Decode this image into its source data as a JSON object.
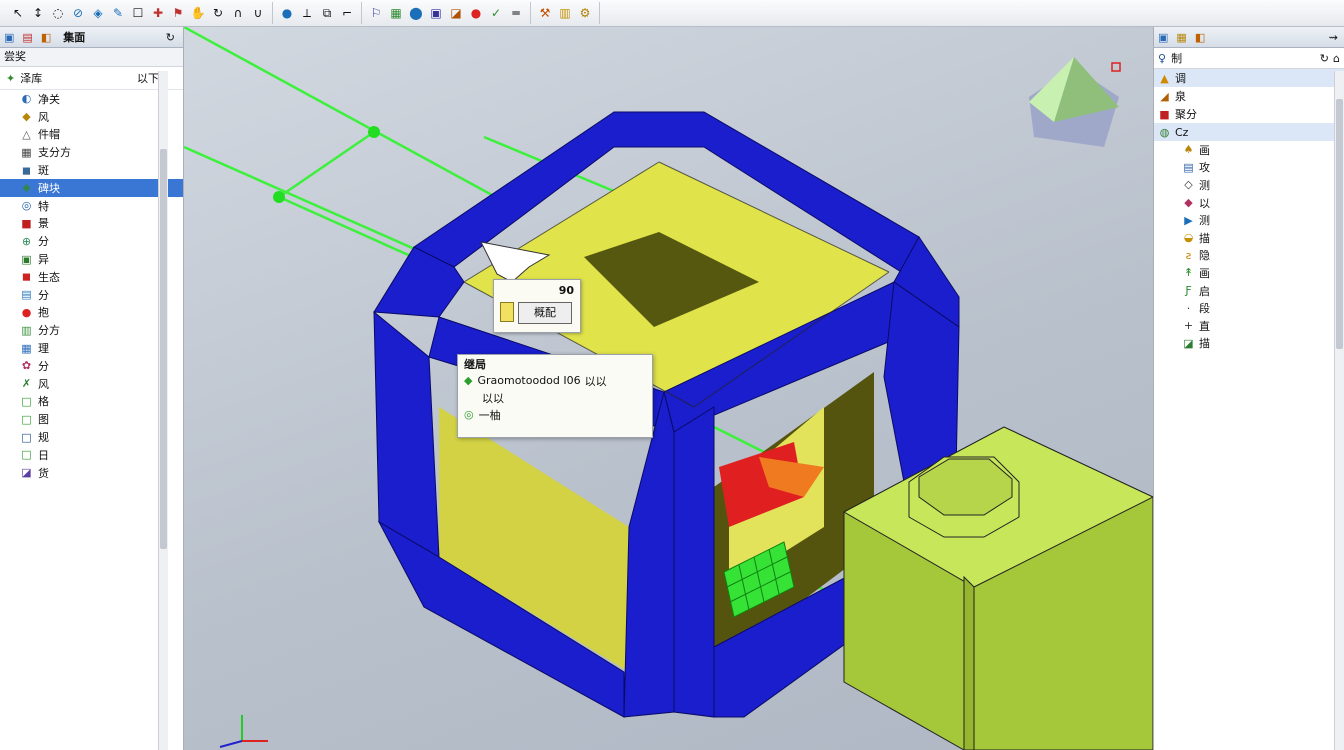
{
  "toolbar": {
    "groups": [
      [
        "arrow-select-icon",
        "pointer-icon",
        "lasso-icon",
        "edge-icon",
        "plane-icon",
        "pen-icon",
        "edit-icon",
        "feature-icon",
        "flag-icon",
        "hand-icon",
        "rotate-icon",
        "hook-icon",
        "magnet-icon"
      ],
      [
        "sphere-icon",
        "measure-icon",
        "mirror-icon",
        "trim-icon"
      ],
      [
        "flag-blue-icon",
        "grid-icon",
        "dot-blue-icon",
        "cube-icon",
        "paint-icon",
        "stop-icon",
        "check-icon",
        "line-icon"
      ],
      [
        "tool-icon",
        "grid-yellow-icon",
        "settings-icon"
      ]
    ]
  },
  "left_panel": {
    "tab_label": "集面",
    "title": "尝奖",
    "head_label": "泽库",
    "head_value": "以下",
    "items": [
      {
        "label": "净关",
        "icon": "◐",
        "color": "#2a6bb8"
      },
      {
        "label": "风",
        "icon": "◆",
        "color": "#b8860b"
      },
      {
        "label": "件帽",
        "icon": "△",
        "color": "#555"
      },
      {
        "label": "支分方",
        "icon": "▦",
        "color": "#444"
      },
      {
        "label": "斑",
        "icon": "◼",
        "color": "#3a6a9a"
      },
      {
        "label": "碑块",
        "icon": "◈",
        "color": "#2f8a2f"
      },
      {
        "label": "特",
        "icon": "◎",
        "color": "#1d5fa8"
      },
      {
        "label": "景",
        "icon": "■",
        "color": "#c02020"
      },
      {
        "label": "分",
        "icon": "⊕",
        "color": "#2e8b57"
      },
      {
        "label": "异",
        "icon": "▣",
        "color": "#2c7a2c"
      },
      {
        "label": "生态",
        "icon": "◼",
        "color": "#c22"
      },
      {
        "label": "分",
        "icon": "▤",
        "color": "#2a7abf"
      },
      {
        "label": "抱",
        "icon": "●",
        "color": "#d22"
      },
      {
        "label": "分方",
        "icon": "▥",
        "color": "#3b8f3b"
      },
      {
        "label": "理",
        "icon": "▦",
        "color": "#2a6bb8"
      },
      {
        "label": "分",
        "icon": "✿",
        "color": "#b03060"
      },
      {
        "label": "风",
        "icon": "✗",
        "color": "#2e7d32"
      },
      {
        "label": "格",
        "icon": "□",
        "color": "#2e9e2e"
      },
      {
        "label": "图",
        "icon": "□",
        "color": "#2e9e2e"
      },
      {
        "label": "规",
        "icon": "□",
        "color": "#1b4f8a"
      },
      {
        "label": "日",
        "icon": "□",
        "color": "#2e9e2e"
      },
      {
        "label": "货",
        "icon": "◪",
        "color": "#5a3fa0"
      }
    ],
    "selected_index": 5
  },
  "viewport": {
    "popup_small": {
      "value": "90",
      "button_label": "概配"
    },
    "popup_big": {
      "title": "继局",
      "line1": "Graomotoodod I06",
      "line1_suffix": "以以",
      "line2": "以以",
      "line3": "一柚"
    }
  },
  "right_panel": {
    "title": "制",
    "rows": [
      {
        "label": "调",
        "icon": "▲",
        "color": "#d08a00",
        "hl": true
      },
      {
        "label": "泉",
        "icon": "◢",
        "color": "#b06000",
        "hl": false
      },
      {
        "label": "聚分",
        "icon": "■",
        "color": "#c02020",
        "hl": false
      },
      {
        "label": "Cz",
        "icon": "◍",
        "color": "#2e7d32",
        "hl": true
      }
    ],
    "subs": [
      {
        "label": "画",
        "icon": "♠",
        "color": "#b8860b"
      },
      {
        "label": "攻",
        "icon": "▤",
        "color": "#3366aa"
      },
      {
        "label": "测",
        "icon": "◇",
        "color": "#333"
      },
      {
        "label": "以",
        "icon": "◆",
        "color": "#b03060"
      },
      {
        "label": "测",
        "icon": "▶",
        "color": "#1b6fb8"
      },
      {
        "label": "描",
        "icon": "◒",
        "color": "#c59000"
      },
      {
        "label": "隐",
        "icon": "ƨ",
        "color": "#c58000"
      },
      {
        "label": "画",
        "icon": "↟",
        "color": "#2e8b2e"
      },
      {
        "label": "启",
        "icon": "Ƒ",
        "color": "#2e8b2e"
      },
      {
        "label": "段",
        "icon": "·",
        "color": "#333"
      },
      {
        "label": "直",
        "icon": "+",
        "color": "#333"
      },
      {
        "label": "描",
        "icon": "◪",
        "color": "#2e7d32"
      }
    ]
  }
}
